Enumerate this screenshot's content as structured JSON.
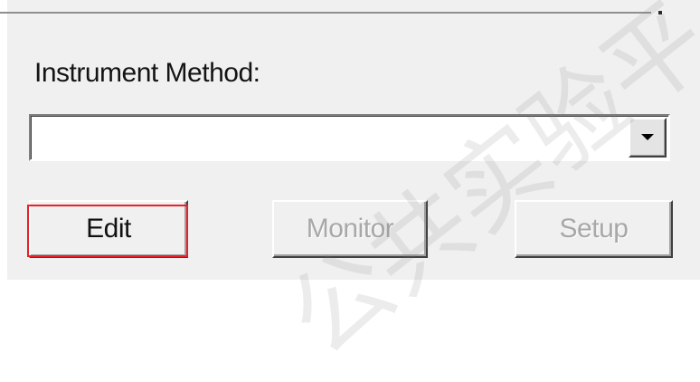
{
  "instrument_method": {
    "label": "Instrument Method:",
    "selected_value": "",
    "dropdown_icon": "triangle-down-icon"
  },
  "buttons": {
    "edit": "Edit",
    "monitor": "Monitor",
    "setup": "Setup"
  },
  "watermark": {
    "text": "公共实验平"
  },
  "colors": {
    "panel_background": "#f0f0f0",
    "disabled_text": "#a8a8a8",
    "highlight_border": "#e8202a"
  }
}
